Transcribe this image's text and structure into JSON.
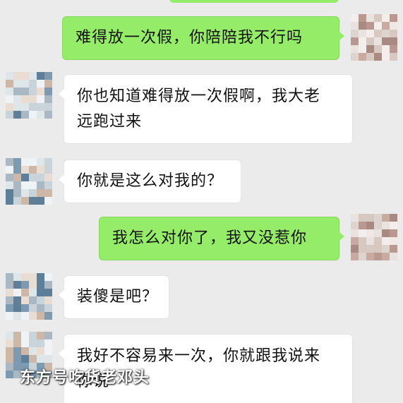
{
  "messages": [
    {
      "sender": "me",
      "lines": [
        "难得放一次假，你陪陪我不行吗"
      ]
    },
    {
      "sender": "other",
      "lines": [
        "你也知道难得放一次假啊，我大老",
        "远跑过来"
      ]
    },
    {
      "sender": "other",
      "lines": [
        "你就是这么对我的？"
      ]
    },
    {
      "sender": "me",
      "lines": [
        "我怎么对你了，我又没惹你"
      ]
    },
    {
      "sender": "other",
      "lines": [
        "装傻是吧？"
      ]
    },
    {
      "sender": "other",
      "lines": [
        "我好不容易来一次，你就跟我说来",
        "你说"
      ]
    }
  ],
  "watermark": "东方号吃货老邓头",
  "colors": {
    "background": "#ebebeb",
    "bubble_me": "#95ec69",
    "bubble_other": "#ffffff"
  }
}
